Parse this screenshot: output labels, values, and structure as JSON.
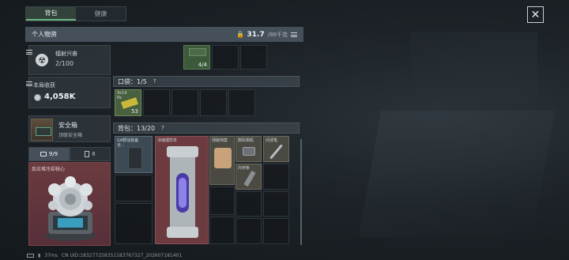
{
  "tabs": [
    {
      "label": "背包",
      "active": true
    },
    {
      "label": "健康",
      "active": false
    }
  ],
  "header": {
    "title": "个人物资",
    "weight": "31.7",
    "weight_max": "/88千克"
  },
  "radiation": {
    "name": "辐射兴奋",
    "count": "2/100"
  },
  "revenue": {
    "label": "本局收获",
    "value": "4,058K"
  },
  "safe": {
    "name": "安全箱",
    "sub": "顶级安全箱"
  },
  "equip_tabs": [
    {
      "label": "9/9",
      "icon": "briefcase-icon"
    },
    {
      "label": "8",
      "icon": "battery-icon"
    }
  ],
  "core_label": "反应堆冷却核心",
  "top_item": {
    "qty": "4/4"
  },
  "pocket": {
    "label": "口袋：",
    "count": "1/5",
    "help": "?",
    "item_label": "9x19",
    "item_sub": "Pa",
    "item_qty": "53"
  },
  "backpack": {
    "label": "背包：",
    "count": "13/20",
    "help": "?",
    "items": [
      {
        "label": "GA野战装备",
        "sub": "全..."
      },
      {
        "label": "浓缩锂样本"
      },
      {
        "label": "残破档案"
      },
      {
        "label": "数码相机"
      },
      {
        "label": "间谍笔"
      },
      {
        "label": "内存条"
      }
    ]
  },
  "footer": {
    "ping": "37ms",
    "uid": "CN UID:183277258351183767327_202607181401"
  },
  "colors": {
    "active_tab": "#33433c",
    "accent_green": "#6bb584",
    "rarity_red": "#6b3b3f",
    "rarity_green": "#4a6b3e"
  }
}
